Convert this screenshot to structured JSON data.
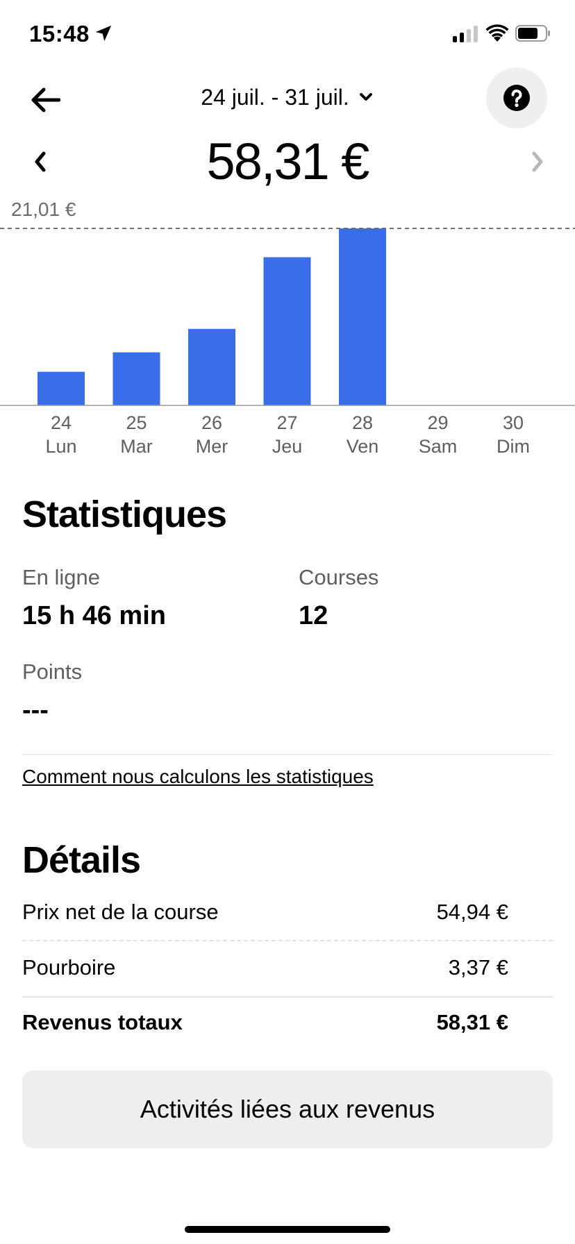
{
  "status_bar": {
    "time": "15:48"
  },
  "header": {
    "date_range": "24 juil. - 31 juil.",
    "total": "58,31 €",
    "accent_color": "#3a6ee8"
  },
  "chart_data": {
    "type": "bar",
    "categories": [
      "24 Lun",
      "25 Mar",
      "26 Mer",
      "27 Jeu",
      "28 Ven",
      "29 Sam",
      "30 Dim"
    ],
    "days": [
      "24",
      "25",
      "26",
      "27",
      "28",
      "29",
      "30"
    ],
    "weekdays": [
      "Lun",
      "Mar",
      "Mer",
      "Jeu",
      "Ven",
      "Sam",
      "Dim"
    ],
    "values": [
      3.99,
      6.3,
      9.08,
      17.59,
      21.01,
      0,
      0
    ],
    "max_label": "21,01 €",
    "ylim": [
      0,
      21.01
    ],
    "grid": false
  },
  "stats": {
    "title": "Statistiques",
    "online_label": "En ligne",
    "online_value": "15 h 46 min",
    "trips_label": "Courses",
    "trips_value": "12",
    "points_label": "Points",
    "points_value": "---",
    "link": "Comment nous calculons les statistiques"
  },
  "details": {
    "title": "Détails",
    "rows": [
      {
        "label": "Prix net de la course",
        "value": "54,94 €"
      },
      {
        "label": "Pourboire",
        "value": "3,37 €"
      },
      {
        "label": "Revenus totaux",
        "value": "58,31 €"
      }
    ]
  },
  "action_button": "Activités liées aux revenus",
  "icons": [
    "location-arrow-icon",
    "signal-icon",
    "wifi-icon",
    "battery-icon",
    "back-arrow-icon",
    "chevron-down-icon",
    "help-icon",
    "chevron-left-icon",
    "chevron-right-icon"
  ]
}
